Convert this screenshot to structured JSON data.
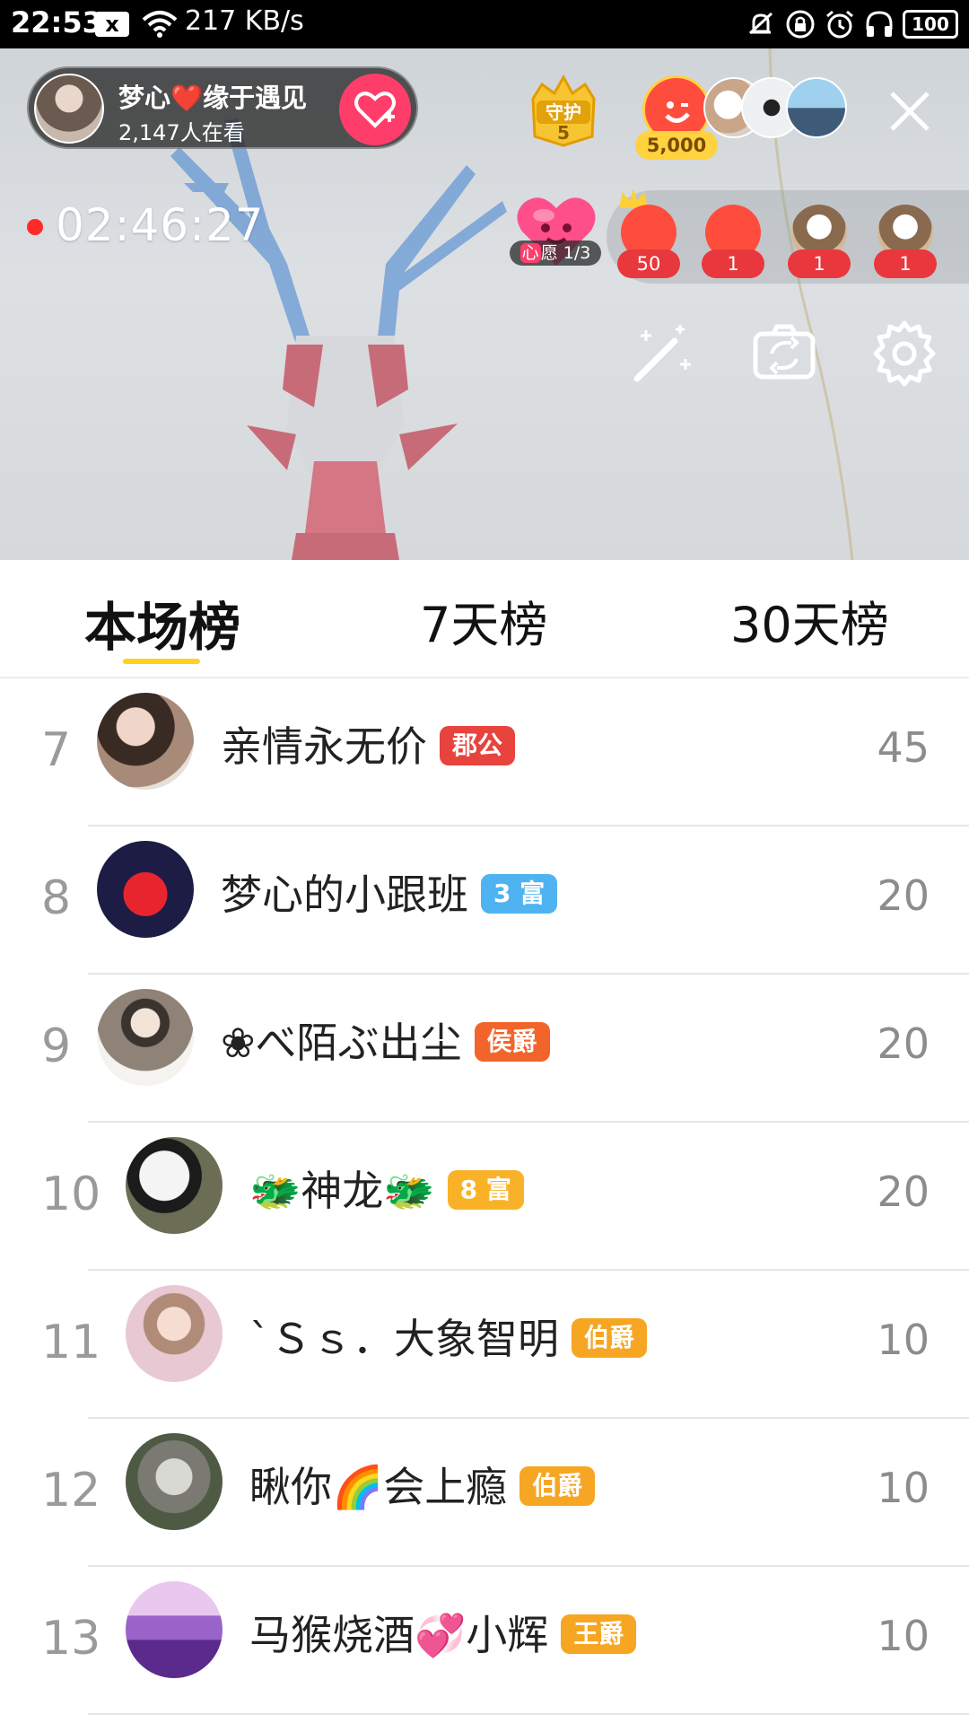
{
  "status_bar": {
    "time": "22:53",
    "network_speed": "217 KB/s",
    "battery": "100",
    "notification_x": "x"
  },
  "host": {
    "name": "梦心❤️缘于遇见",
    "viewers": "2,147人在看"
  },
  "guard": {
    "label": "守护",
    "count": "5"
  },
  "top_contribution": "5,000",
  "timer": "02:46:27",
  "wish": {
    "xin": "心",
    "label": "愿 1/3"
  },
  "rank_strip": [
    {
      "count": "50"
    },
    {
      "count": "1"
    },
    {
      "count": "1"
    },
    {
      "count": "1"
    }
  ],
  "tabs": [
    {
      "label": "本场榜",
      "active": true
    },
    {
      "label": "7天榜",
      "active": false
    },
    {
      "label": "30天榜",
      "active": false
    }
  ],
  "leaderboard": [
    {
      "rank": "7",
      "name": "亲情永无价",
      "badge": "郡公",
      "badge_color": "#e8433d",
      "score": "45"
    },
    {
      "rank": "8",
      "name": "梦心的小跟班",
      "badge": "3 富",
      "badge_color": "#4fb3f2",
      "score": "20"
    },
    {
      "rank": "9",
      "name": "❀べ陌ぶ出尘",
      "badge": "侯爵",
      "badge_color": "#f2652a",
      "score": "20"
    },
    {
      "rank": "10",
      "name": "🐲神龙🐲",
      "badge": "8 富",
      "badge_color": "#f9b228",
      "score": "20"
    },
    {
      "rank": "11",
      "name": "ˋＳｓ．大象智明",
      "badge": "伯爵",
      "badge_color": "#f6a623",
      "score": "10"
    },
    {
      "rank": "12",
      "name": "瞅你🌈会上瘾",
      "badge": "伯爵",
      "badge_color": "#f6a623",
      "score": "10"
    },
    {
      "rank": "13",
      "name": "马猴烧酒💞小辉",
      "badge": "王爵",
      "badge_color": "#f6a623",
      "score": "10"
    }
  ]
}
